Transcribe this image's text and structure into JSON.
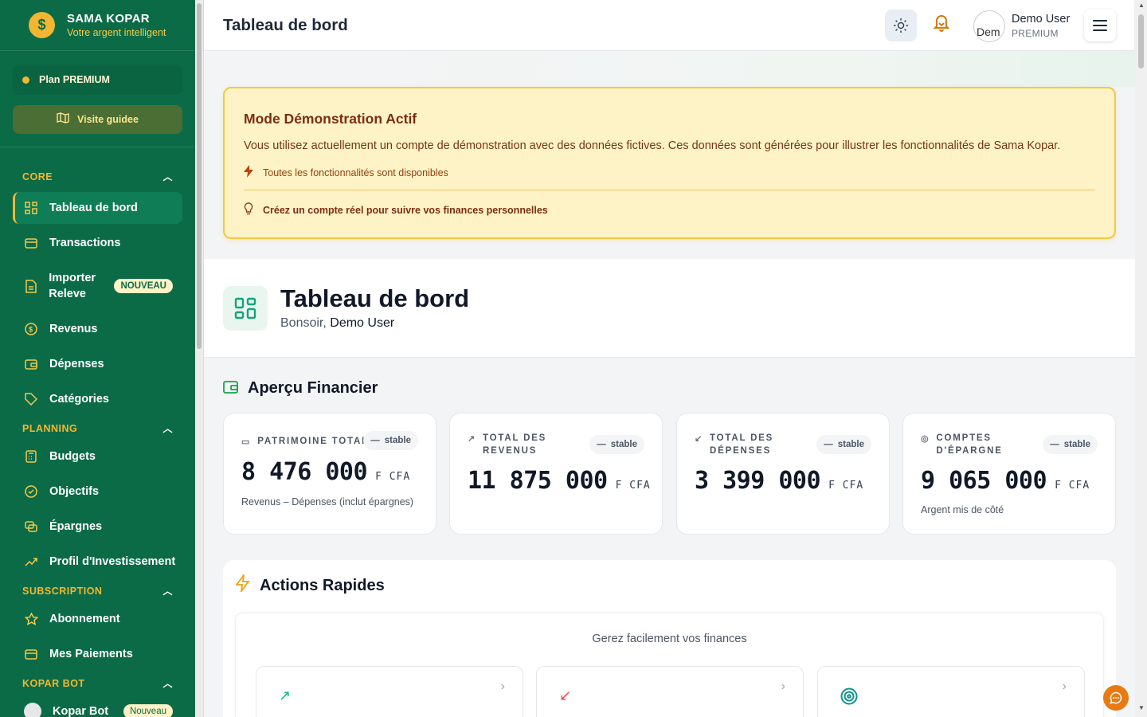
{
  "brand": {
    "name": "SAMA KOPAR",
    "tagline": "Votre argent intelligent"
  },
  "sidebar": {
    "plan": "Plan PREMIUM",
    "guide": "Visite guidee",
    "sections": [
      {
        "label": "CORE",
        "items": [
          {
            "label": "Tableau de bord",
            "icon": "grid-icon",
            "active": true
          },
          {
            "label": "Transactions",
            "icon": "card-icon"
          },
          {
            "label": "Importer Releve",
            "icon": "file-icon",
            "badge": "NOUVEAU"
          },
          {
            "label": "Revenus",
            "icon": "dollar-icon"
          },
          {
            "label": "Dépenses",
            "icon": "wallet-icon"
          },
          {
            "label": "Catégories",
            "icon": "tag-icon"
          }
        ]
      },
      {
        "label": "PLANNING",
        "items": [
          {
            "label": "Budgets",
            "icon": "calculator-icon"
          },
          {
            "label": "Objectifs",
            "icon": "check-circle-icon"
          },
          {
            "label": "Épargnes",
            "icon": "stack-icon"
          },
          {
            "label": "Profil d'Investissement",
            "icon": "trend-up-icon"
          }
        ]
      },
      {
        "label": "SUBSCRIPTION",
        "items": [
          {
            "label": "Abonnement",
            "icon": "star-icon"
          },
          {
            "label": "Mes Paiements",
            "icon": "card-icon"
          }
        ]
      },
      {
        "label": "KOPAR BOT",
        "items": [
          {
            "label": "Kopar Bot",
            "icon": "bot-icon",
            "badge": "Nouveau"
          }
        ]
      }
    ]
  },
  "header": {
    "title": "Tableau de bord",
    "user_name": "Demo User",
    "user_role": "PREMIUM",
    "avatar_alt": "Dem"
  },
  "demo": {
    "title": "Mode Démonstration Actif",
    "text": "Vous utilisez actuellement un compte de démonstration avec des données fictives. Ces données sont générées pour illustrer les fonctionnalités de Sama Kopar.",
    "feature": "Toutes les fonctionnalités sont disponibles",
    "cta": "Créez un compte réel pour suivre vos finances personnelles"
  },
  "hero": {
    "title": "Tableau de bord",
    "greeting": "Bonsoir,",
    "user": "Demo User"
  },
  "overview": {
    "title": "Aperçu Financier",
    "cards": [
      {
        "label": "PATRIMOINE TOTAL",
        "value": "8 476 000",
        "currency": "F CFA",
        "trend": "stable",
        "note": "Revenus – Dépenses (inclut épargnes)"
      },
      {
        "label": "TOTAL DES REVENUS",
        "value": "11 875 000",
        "currency": "F CFA",
        "trend": "stable",
        "note": ""
      },
      {
        "label": "TOTAL DES DÉPENSES",
        "value": "3 399 000",
        "currency": "F CFA",
        "trend": "stable",
        "note": ""
      },
      {
        "label": "COMPTES D'ÉPARGNE",
        "value": "9 065 000",
        "currency": "F CFA",
        "trend": "stable",
        "note": "Argent mis de côté"
      }
    ]
  },
  "actions": {
    "title": "Actions Rapides",
    "subtitle": "Gerez facilement vos finances"
  },
  "colors": {
    "sidebar": "#0b6b47",
    "accent": "#f2b632",
    "demo_bg": "#fef3c7"
  }
}
